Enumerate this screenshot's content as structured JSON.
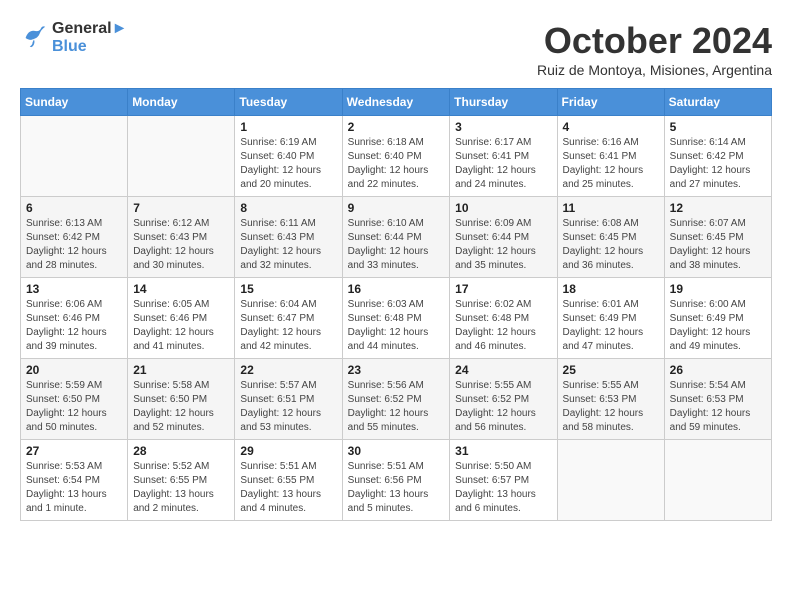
{
  "header": {
    "logo_line1": "General",
    "logo_line2": "Blue",
    "month_title": "October 2024",
    "subtitle": "Ruiz de Montoya, Misiones, Argentina"
  },
  "weekdays": [
    "Sunday",
    "Monday",
    "Tuesday",
    "Wednesday",
    "Thursday",
    "Friday",
    "Saturday"
  ],
  "weeks": [
    [
      {
        "day": "",
        "info": ""
      },
      {
        "day": "",
        "info": ""
      },
      {
        "day": "1",
        "info": "Sunrise: 6:19 AM\nSunset: 6:40 PM\nDaylight: 12 hours and 20 minutes."
      },
      {
        "day": "2",
        "info": "Sunrise: 6:18 AM\nSunset: 6:40 PM\nDaylight: 12 hours and 22 minutes."
      },
      {
        "day": "3",
        "info": "Sunrise: 6:17 AM\nSunset: 6:41 PM\nDaylight: 12 hours and 24 minutes."
      },
      {
        "day": "4",
        "info": "Sunrise: 6:16 AM\nSunset: 6:41 PM\nDaylight: 12 hours and 25 minutes."
      },
      {
        "day": "5",
        "info": "Sunrise: 6:14 AM\nSunset: 6:42 PM\nDaylight: 12 hours and 27 minutes."
      }
    ],
    [
      {
        "day": "6",
        "info": "Sunrise: 6:13 AM\nSunset: 6:42 PM\nDaylight: 12 hours and 28 minutes."
      },
      {
        "day": "7",
        "info": "Sunrise: 6:12 AM\nSunset: 6:43 PM\nDaylight: 12 hours and 30 minutes."
      },
      {
        "day": "8",
        "info": "Sunrise: 6:11 AM\nSunset: 6:43 PM\nDaylight: 12 hours and 32 minutes."
      },
      {
        "day": "9",
        "info": "Sunrise: 6:10 AM\nSunset: 6:44 PM\nDaylight: 12 hours and 33 minutes."
      },
      {
        "day": "10",
        "info": "Sunrise: 6:09 AM\nSunset: 6:44 PM\nDaylight: 12 hours and 35 minutes."
      },
      {
        "day": "11",
        "info": "Sunrise: 6:08 AM\nSunset: 6:45 PM\nDaylight: 12 hours and 36 minutes."
      },
      {
        "day": "12",
        "info": "Sunrise: 6:07 AM\nSunset: 6:45 PM\nDaylight: 12 hours and 38 minutes."
      }
    ],
    [
      {
        "day": "13",
        "info": "Sunrise: 6:06 AM\nSunset: 6:46 PM\nDaylight: 12 hours and 39 minutes."
      },
      {
        "day": "14",
        "info": "Sunrise: 6:05 AM\nSunset: 6:46 PM\nDaylight: 12 hours and 41 minutes."
      },
      {
        "day": "15",
        "info": "Sunrise: 6:04 AM\nSunset: 6:47 PM\nDaylight: 12 hours and 42 minutes."
      },
      {
        "day": "16",
        "info": "Sunrise: 6:03 AM\nSunset: 6:48 PM\nDaylight: 12 hours and 44 minutes."
      },
      {
        "day": "17",
        "info": "Sunrise: 6:02 AM\nSunset: 6:48 PM\nDaylight: 12 hours and 46 minutes."
      },
      {
        "day": "18",
        "info": "Sunrise: 6:01 AM\nSunset: 6:49 PM\nDaylight: 12 hours and 47 minutes."
      },
      {
        "day": "19",
        "info": "Sunrise: 6:00 AM\nSunset: 6:49 PM\nDaylight: 12 hours and 49 minutes."
      }
    ],
    [
      {
        "day": "20",
        "info": "Sunrise: 5:59 AM\nSunset: 6:50 PM\nDaylight: 12 hours and 50 minutes."
      },
      {
        "day": "21",
        "info": "Sunrise: 5:58 AM\nSunset: 6:50 PM\nDaylight: 12 hours and 52 minutes."
      },
      {
        "day": "22",
        "info": "Sunrise: 5:57 AM\nSunset: 6:51 PM\nDaylight: 12 hours and 53 minutes."
      },
      {
        "day": "23",
        "info": "Sunrise: 5:56 AM\nSunset: 6:52 PM\nDaylight: 12 hours and 55 minutes."
      },
      {
        "day": "24",
        "info": "Sunrise: 5:55 AM\nSunset: 6:52 PM\nDaylight: 12 hours and 56 minutes."
      },
      {
        "day": "25",
        "info": "Sunrise: 5:55 AM\nSunset: 6:53 PM\nDaylight: 12 hours and 58 minutes."
      },
      {
        "day": "26",
        "info": "Sunrise: 5:54 AM\nSunset: 6:53 PM\nDaylight: 12 hours and 59 minutes."
      }
    ],
    [
      {
        "day": "27",
        "info": "Sunrise: 5:53 AM\nSunset: 6:54 PM\nDaylight: 13 hours and 1 minute."
      },
      {
        "day": "28",
        "info": "Sunrise: 5:52 AM\nSunset: 6:55 PM\nDaylight: 13 hours and 2 minutes."
      },
      {
        "day": "29",
        "info": "Sunrise: 5:51 AM\nSunset: 6:55 PM\nDaylight: 13 hours and 4 minutes."
      },
      {
        "day": "30",
        "info": "Sunrise: 5:51 AM\nSunset: 6:56 PM\nDaylight: 13 hours and 5 minutes."
      },
      {
        "day": "31",
        "info": "Sunrise: 5:50 AM\nSunset: 6:57 PM\nDaylight: 13 hours and 6 minutes."
      },
      {
        "day": "",
        "info": ""
      },
      {
        "day": "",
        "info": ""
      }
    ]
  ]
}
